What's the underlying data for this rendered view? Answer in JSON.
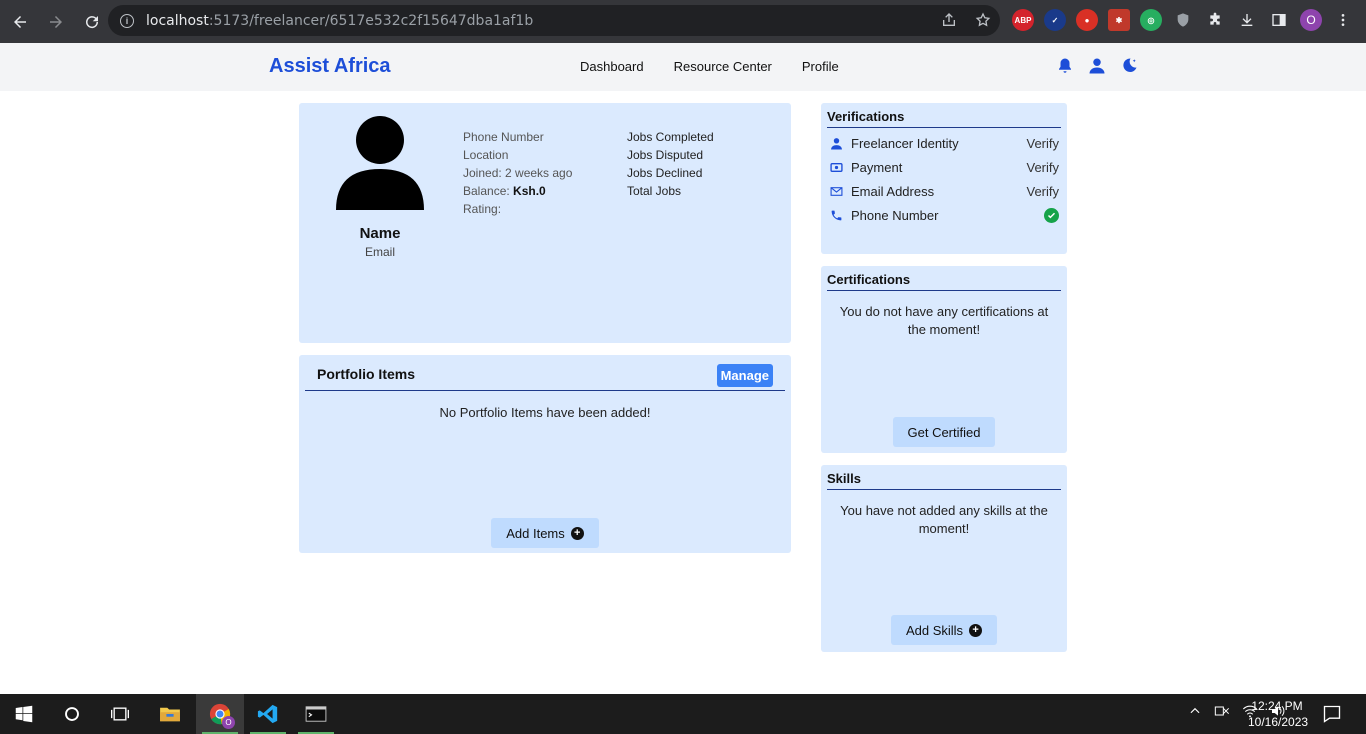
{
  "browser": {
    "url_host": "localhost",
    "url_rest": ":5173/freelancer/6517e532c2f15647dba1af1b",
    "profile_initial": "O",
    "ext_abp": "ABP"
  },
  "app": {
    "brand": "Assist Africa",
    "menu": [
      "Dashboard",
      "Resource Center",
      "Profile"
    ],
    "accent": "#1d4ed8"
  },
  "profile": {
    "name": "Name",
    "email": "Email",
    "info_left": {
      "phone": "Phone Number",
      "location": "Location",
      "joined": "Joined: 2 weeks ago",
      "balance_label": "Balance: ",
      "balance_value": "Ksh.0",
      "rating": "Rating:"
    },
    "info_right": [
      "Jobs Completed",
      "Jobs Disputed",
      "Jobs Declined",
      "Total Jobs"
    ]
  },
  "portfolio": {
    "title": "Portfolio Items",
    "manage": "Manage",
    "empty": "No Portfolio Items have been added!",
    "add": "Add Items"
  },
  "verifications": {
    "title": "Verifications",
    "items": [
      {
        "label": "Freelancer Identity",
        "action": "Verify",
        "icon": "user-icon"
      },
      {
        "label": "Payment",
        "action": "Verify",
        "icon": "payment-icon"
      },
      {
        "label": "Email Address",
        "action": "Verify",
        "icon": "mail-icon"
      },
      {
        "label": "Phone Number",
        "action": "",
        "icon": "phone-icon",
        "verified": true
      }
    ]
  },
  "certifications": {
    "title": "Certifications",
    "empty": "You do not have any certifications at the moment!",
    "button": "Get Certified"
  },
  "skills": {
    "title": "Skills",
    "empty": "You have not added any skills at the moment!",
    "button": "Add Skills"
  },
  "taskbar": {
    "time": "12:24 PM",
    "date": "10/16/2023",
    "chrome_badge": "O"
  }
}
